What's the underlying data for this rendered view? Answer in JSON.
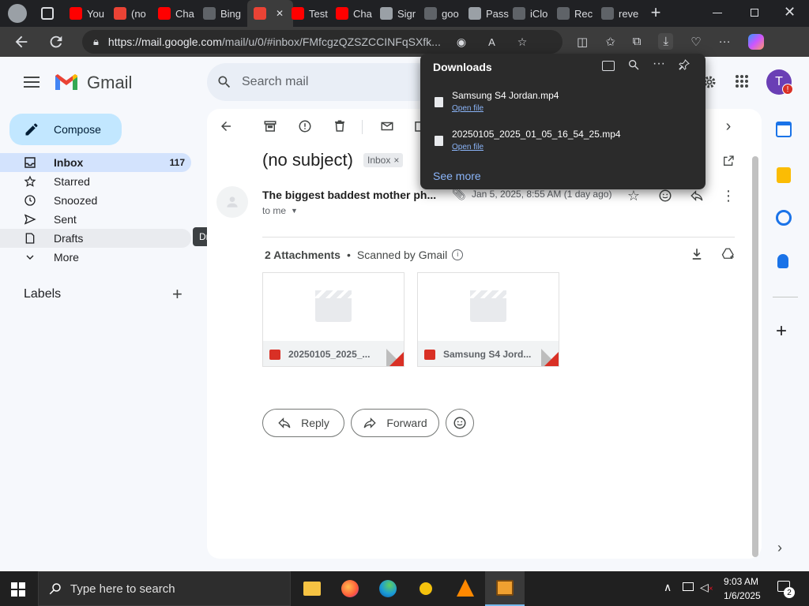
{
  "browser": {
    "tabs": [
      {
        "label": "You",
        "color": "#ff0000"
      },
      {
        "label": "(no",
        "color": "#ea4335"
      },
      {
        "label": "Cha",
        "color": "#ff0000"
      },
      {
        "label": "Bing",
        "color": "#5f6368"
      },
      {
        "label": "",
        "color": "#ea4335",
        "active": true
      },
      {
        "label": "Test",
        "color": "#ff0000"
      },
      {
        "label": "Cha",
        "color": "#ff0000"
      },
      {
        "label": "Sigr",
        "color": "#9aa0a6"
      },
      {
        "label": "goo",
        "color": "#5f6368"
      },
      {
        "label": "Pass",
        "color": "#9aa0a6"
      },
      {
        "label": "iClo",
        "color": "#5f6368"
      },
      {
        "label": "Rec",
        "color": "#5f6368"
      },
      {
        "label": "reve",
        "color": "#5f6368"
      }
    ],
    "url_host": "https://mail.google.com",
    "url_path": "/mail/u/0/#inbox/FMfcgzQZSZCCINFqSXfk..."
  },
  "gmail": {
    "logo_text": "Gmail",
    "search_placeholder": "Search mail",
    "compose_label": "Compose",
    "nav": [
      {
        "label": "Inbox",
        "count": "117",
        "icon": "inbox-icon"
      },
      {
        "label": "Starred",
        "count": "",
        "icon": "star-icon"
      },
      {
        "label": "Snoozed",
        "count": "",
        "icon": "clock-icon"
      },
      {
        "label": "Sent",
        "count": "",
        "icon": "send-icon"
      },
      {
        "label": "Drafts",
        "count": "",
        "icon": "draft-icon"
      },
      {
        "label": "More",
        "count": "",
        "icon": "chevron-down-icon"
      }
    ],
    "tooltip": "Drafts",
    "labels_heading": "Labels",
    "avatar_letter": "T",
    "email": {
      "subject": "(no subject)",
      "label_chip": "Inbox",
      "sender": "The biggest baddest mother ph...",
      "date": "Jan 5, 2025, 8:55 AM (1 day ago)",
      "to": "to me",
      "attachments_title": "2 Attachments",
      "scanned": "Scanned by Gmail",
      "attachments": [
        {
          "name": "20250105_2025_..."
        },
        {
          "name": "Samsung S4 Jord..."
        }
      ],
      "reply_label": "Reply",
      "forward_label": "Forward"
    }
  },
  "downloads": {
    "title": "Downloads",
    "items": [
      {
        "name": "Samsung S4 Jordan.mp4",
        "action": "Open file"
      },
      {
        "name": "20250105_2025_01_05_16_54_25.mp4",
        "action": "Open file"
      }
    ],
    "see_more": "See more"
  },
  "taskbar": {
    "search_placeholder": "Type here to search",
    "time": "9:03 AM",
    "date": "1/6/2025",
    "notification_count": "2"
  },
  "colors": {
    "accent": "#0b57d0",
    "compose_bg": "#c2e7ff",
    "selected_nav": "#d3e3fd",
    "attachment_red": "#d93025"
  }
}
